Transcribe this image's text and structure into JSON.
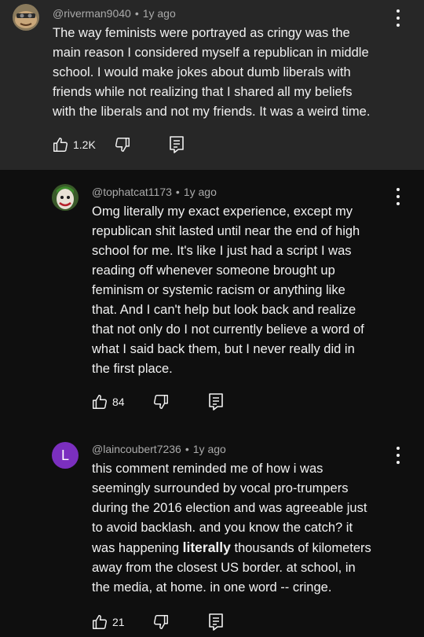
{
  "comments": [
    {
      "author": "@riverman9040",
      "age": "1y ago",
      "lines": [
        "The way feminists were portrayed as cringy was the",
        "main reason I considered myself a republican in middle",
        "school. I would make jokes about dumb liberals with",
        "friends while not realizing that I shared all my beliefs",
        "with the liberals and not my friends. It was a weird time."
      ],
      "likes": "1.2K"
    },
    {
      "author": "@tophatcat1173",
      "age": "1y ago",
      "lines": [
        "Omg literally my exact experience, except my",
        "republican shit lasted until near the end of high",
        "school for me. It's like I just had a script I was",
        "reading off whenever someone brought up",
        "feminism or systemic racism or anything like",
        "that. And I can't help but look back and realize",
        "that not only do I not currently believe a word of",
        "what I said back them, but I never really did in",
        "the first place."
      ],
      "likes": "84"
    },
    {
      "author": "@laincoubert7236",
      "age": "1y ago",
      "avatar_letter": "L",
      "avatar_color": "#7b2fbf",
      "lines": [
        "this comment reminded me of how i was",
        "seemingly surrounded by vocal pro-trumpers",
        "during the 2016 election and was agreeable just",
        "to avoid backlash. and you know the catch? it",
        "thousands of kilometers",
        "away from the closest US border. at school, in",
        "the media, at home. in one word -- cringe."
      ],
      "line5_prefix": "was happening ",
      "line5_bold": "literally",
      "likes": "21"
    }
  ],
  "icons": {
    "like": "thumbs-up-icon",
    "dislike": "thumbs-down-icon",
    "reply": "reply-icon",
    "more": "more-vertical-icon"
  }
}
